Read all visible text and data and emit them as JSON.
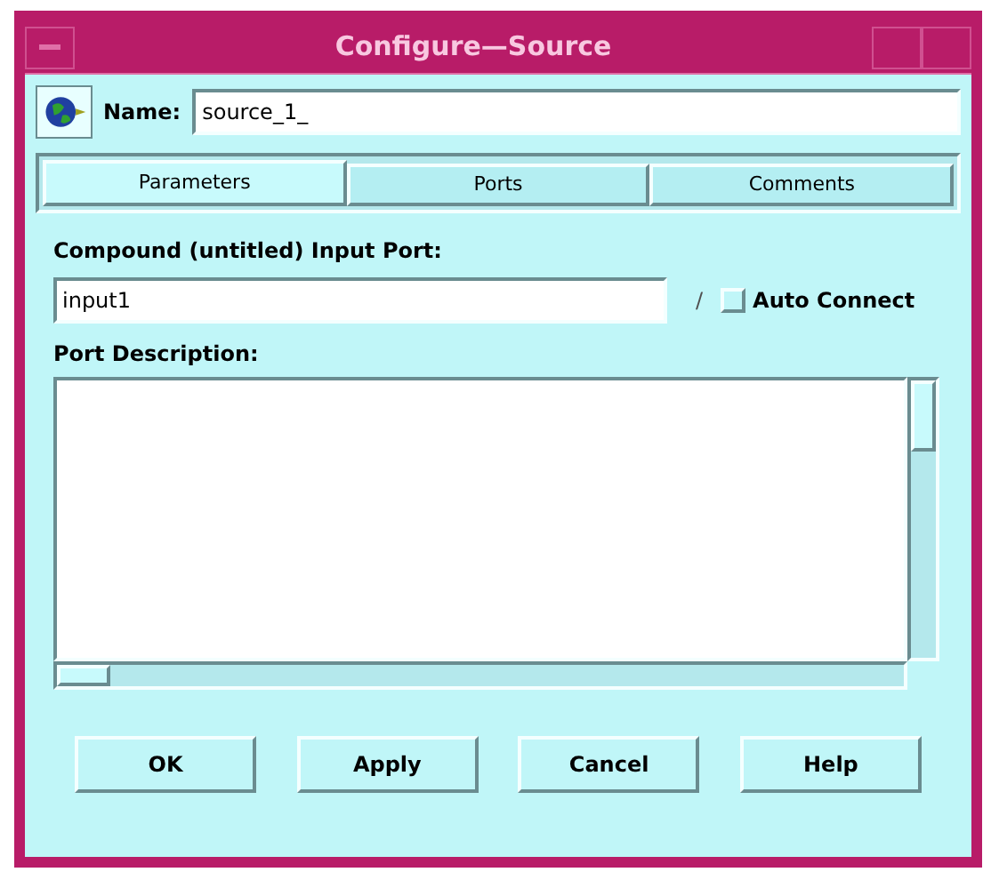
{
  "window": {
    "title": "Configure—Source"
  },
  "name_field": {
    "label": "Name:",
    "value": "source_1_"
  },
  "tabs": [
    {
      "label": "Parameters",
      "selected": true
    },
    {
      "label": "Ports",
      "selected": false
    },
    {
      "label": "Comments",
      "selected": false
    }
  ],
  "port": {
    "label": "Compound (untitled) Input Port:",
    "value": "input1",
    "separator": "/",
    "auto_connect": {
      "label": "Auto Connect",
      "checked": false
    }
  },
  "description": {
    "label": "Port Description:"
  },
  "buttons": [
    "OK",
    "Apply",
    "Cancel",
    "Help"
  ]
}
